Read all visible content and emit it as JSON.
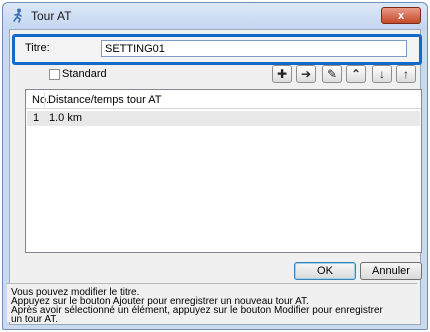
{
  "window": {
    "title": "Tour AT",
    "close_glyph": "x"
  },
  "title_field": {
    "label": "Titre:",
    "value": "SETTING01"
  },
  "standard_checkbox": {
    "label": "Standard",
    "checked": false
  },
  "toolbar": {
    "buttons": [
      {
        "icon": "plus-icon",
        "glyph": "✚"
      },
      {
        "icon": "arrow-right-icon",
        "glyph": "➔"
      },
      {
        "icon": "pencil-icon",
        "glyph": "✎"
      },
      {
        "icon": "erase-icon",
        "glyph": "⌃"
      },
      {
        "icon": "arrow-down-icon",
        "glyph": "↓"
      },
      {
        "icon": "arrow-up-icon",
        "glyph": "↑"
      }
    ]
  },
  "list": {
    "columns": [
      "No.",
      "Distance/temps tour AT"
    ],
    "rows": [
      {
        "no": "1",
        "distance": "1.0 km"
      }
    ]
  },
  "buttons": {
    "ok": "OK",
    "cancel": "Annuler"
  },
  "help": {
    "lines": [
      "Vous pouvez modifier le titre.",
      "Appuyez sur le bouton Ajouter pour enregistrer un nouveau tour AT.",
      "Après avoir sélectionné un élément, appuyez sur le bouton Modifier pour enregistrer",
      "un tour AT."
    ]
  },
  "colors": {
    "focus_border": "#1169c9",
    "selected_row": "#e8e8e8",
    "close_button": "#c24a2c"
  }
}
